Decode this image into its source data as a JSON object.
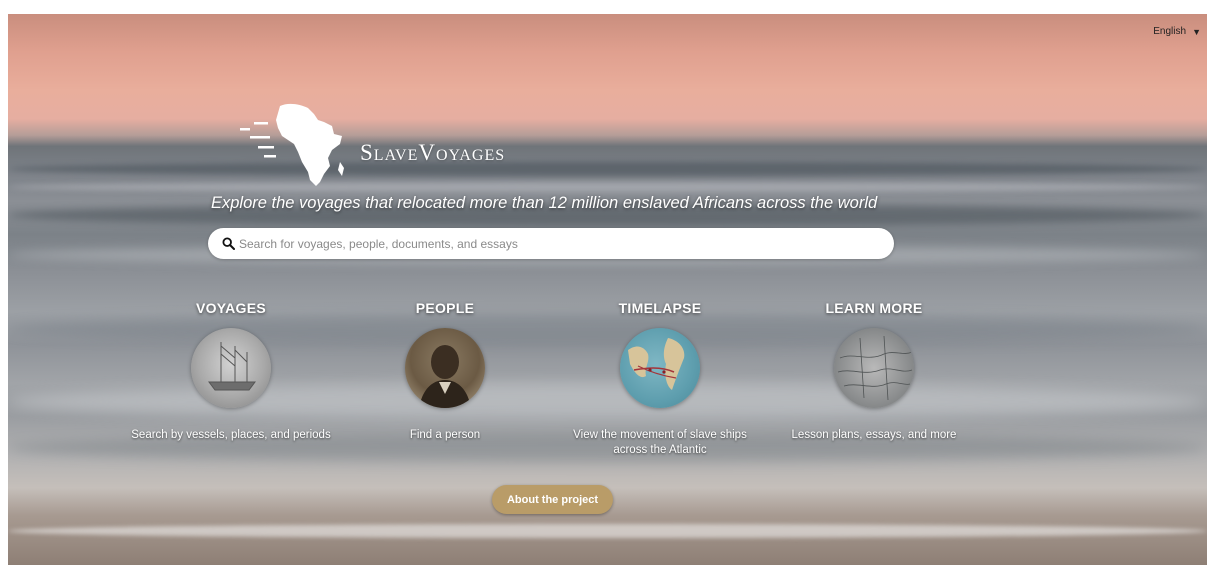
{
  "language": {
    "selected": "English"
  },
  "brand": {
    "name": "SlaveVoyages"
  },
  "tagline": "Explore the voyages that relocated more than 12 million enslaved Africans across the world",
  "search": {
    "placeholder": "Search for voyages, people, documents, and essays"
  },
  "sections": [
    {
      "title": "VOYAGES",
      "description": "Search by vessels, places, and periods"
    },
    {
      "title": "PEOPLE",
      "description": "Find a person"
    },
    {
      "title": "TIMELAPSE",
      "description": "View the movement of slave ships across the Atlantic"
    },
    {
      "title": "LEARN MORE",
      "description": "Lesson plans, essays, and more"
    }
  ],
  "about_button": "About the project",
  "colors": {
    "accent": "#b99c68",
    "text": "#ffffff"
  }
}
